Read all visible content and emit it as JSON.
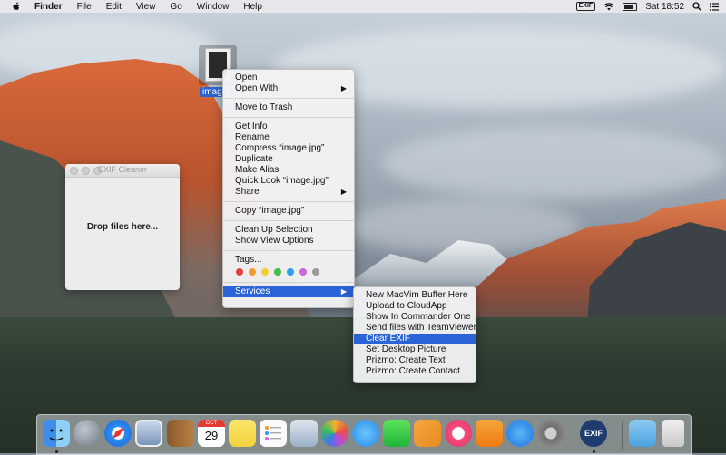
{
  "menubar": {
    "app_name": "Finder",
    "items": [
      "File",
      "Edit",
      "View",
      "Go",
      "Window",
      "Help"
    ],
    "exif_badge": "EXIF",
    "clock": "Sat 18:52",
    "icons": [
      "apple-icon",
      "wifi-icon",
      "battery-icon",
      "search-icon",
      "list-icon"
    ]
  },
  "desktop": {
    "file_label": "image.jpg"
  },
  "exif_window": {
    "title": "EXIF Cleaner",
    "drop_text": "Drop files here..."
  },
  "context_menu": {
    "open": "Open",
    "open_with": "Open With",
    "move_to_trash": "Move to Trash",
    "get_info": "Get Info",
    "rename": "Rename",
    "compress": "Compress “image.jpg”",
    "duplicate": "Duplicate",
    "make_alias": "Make Alias",
    "quick_look": "Quick Look “image.jpg”",
    "share": "Share",
    "copy": "Copy “image.jpg”",
    "clean_up": "Clean Up Selection",
    "show_view_options": "Show View Options",
    "tags": "Tags...",
    "services": "Services",
    "tag_colors": [
      "#e0413b",
      "#f29b2c",
      "#f1cd3a",
      "#4bbc4a",
      "#2f9ef2",
      "#c66bd8",
      "#9a9a9a"
    ]
  },
  "services_menu": {
    "items": [
      "New MacVim Buffer Here",
      "Upload to CloudApp",
      "Show In Commander One",
      "Send files with TeamViewer",
      "Clear EXIF",
      "Set Desktop Picture",
      "Prizmo: Create Text",
      "Prizmo: Create Contact"
    ],
    "highlighted": "Clear EXIF"
  },
  "dock": {
    "calendar_month": "OCT",
    "calendar_day": "29",
    "exif_label": "EXIF",
    "accent": "#2b64d6"
  }
}
